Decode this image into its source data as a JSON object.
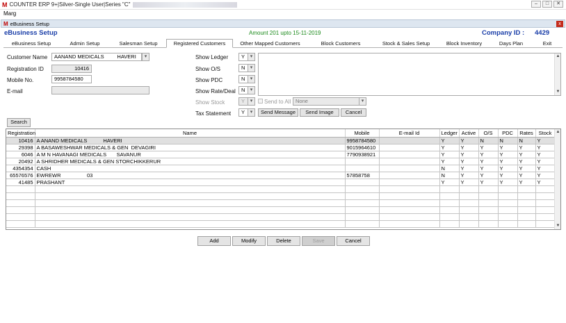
{
  "window": {
    "logo_text": "M",
    "title": "COUNTER ERP 9+|Silver-Single User|Series \"C\"",
    "buttons": [
      "–",
      "□",
      "✕"
    ]
  },
  "menubar": {
    "label": "Marg"
  },
  "dialog": {
    "logo_text": "M",
    "title": "eBusiness Setup",
    "close_label": "x"
  },
  "header": {
    "title": "eBusiness Setup",
    "amount": "Amount 201 upto 15-11-2019",
    "company_label": "Company ID :",
    "company_id": "4429"
  },
  "tabs": [
    {
      "label": "eBusiness Setup"
    },
    {
      "label": "Admin Setup"
    },
    {
      "label": "Salesman Setup"
    },
    {
      "label": "Registered Customers"
    },
    {
      "label": "Other Mapped Customers"
    },
    {
      "label": "Block Customers"
    },
    {
      "label": "Stock & Sales Setup"
    },
    {
      "label": "Block Inventory"
    },
    {
      "label": "Days Plan"
    },
    {
      "label": "Exit"
    }
  ],
  "form": {
    "customer_name_label": "Customer Name",
    "customer_name_value": "AANAND MEDICALS         HAVERI",
    "registration_id_label": "Registration ID",
    "registration_id_value": "10416",
    "mobile_label": "Mobile No.",
    "mobile_value": "9958784580",
    "email_label": "E-mail",
    "email_value": "",
    "show_ledger_label": "Show Ledger",
    "show_ledger_value": "Y",
    "show_os_label": "Show O/S",
    "show_os_value": "N",
    "show_pdc_label": "Show PDC",
    "show_pdc_value": "N",
    "show_rate_label": "Show Rate/Deal",
    "show_rate_value": "N",
    "show_stock_label": "Show Stock",
    "show_stock_value": "Y",
    "send_to_all_label": "Send to All",
    "none_value": "None",
    "tax_statement_label": "Tax Statement",
    "tax_statement_value": "Y",
    "send_message_label": "Send Message",
    "send_image_label": "Send Image",
    "cancel_label": "Cancel",
    "search_label": "Search"
  },
  "grid": {
    "columns": [
      "Registration",
      "Name",
      "Mobile",
      "E-mail Id",
      "Ledger",
      "Active",
      "O/S",
      "PDC",
      "Rates",
      "Stock"
    ],
    "rows": [
      [
        "10416",
        "A ANAND MEDICALS           HAVERI",
        "9958784580",
        "",
        "Y",
        "Y",
        "N",
        "N",
        "N",
        "Y"
      ],
      [
        "29398",
        "A BASAWESHWAR MEDICALS & GEN  DEVAGIRI",
        "9015964610",
        "",
        "Y",
        "Y",
        "Y",
        "Y",
        "Y",
        "Y"
      ],
      [
        "6046",
        "A M N HAVANAGI MEDICALS       SAVANUR",
        "7790938921",
        "",
        "Y",
        "Y",
        "Y",
        "Y",
        "Y",
        "Y"
      ],
      [
        "20492",
        "A SHRIDHER MEDICALS & GEN STORCHIKKERUR",
        "",
        "",
        "Y",
        "Y",
        "Y",
        "Y",
        "Y",
        "Y"
      ],
      [
        "4354354",
        "CASH",
        "",
        "",
        "N",
        "Y",
        "Y",
        "Y",
        "Y",
        "Y"
      ],
      [
        "65576576",
        "EWREWR                  03",
        "57858758",
        "",
        "N",
        "Y",
        "Y",
        "Y",
        "Y",
        "Y"
      ],
      [
        "41485",
        "PRASHANT",
        "",
        "",
        "Y",
        "Y",
        "Y",
        "Y",
        "Y",
        "Y"
      ]
    ],
    "empty_rows": 6
  },
  "actions": {
    "add": "Add",
    "modify": "Modify",
    "delete": "Delete",
    "save": "Save",
    "cancel": "Cancel"
  },
  "icons": {
    "dropdown": "chevron-down-icon",
    "scroll_up": "scroll-up-icon",
    "scroll_down": "scroll-down-icon"
  },
  "colors": {
    "header_blue": "#1a3ea8",
    "amount_green": "#1b8a1b",
    "logo_red": "#c00000",
    "close_red": "#c42b1c"
  }
}
